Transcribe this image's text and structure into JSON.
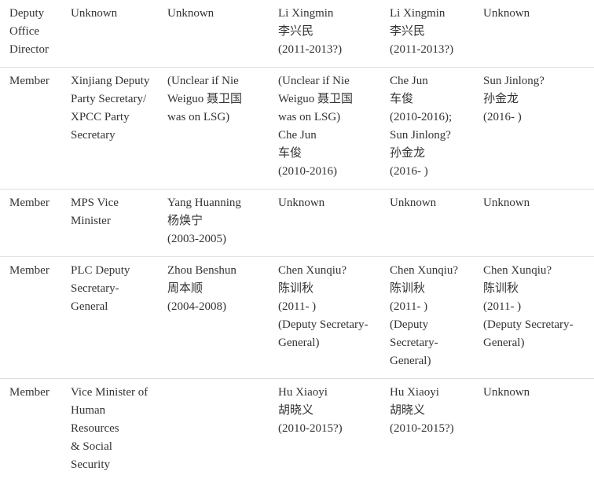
{
  "rows": [
    {
      "cells": [
        [
          "Deputy",
          "Office",
          "Director"
        ],
        [
          "Unknown"
        ],
        [
          "Unknown"
        ],
        [
          "Li Xingmin",
          "李兴民",
          "(2011-2013?)"
        ],
        [
          "Li Xingmin",
          "李兴民",
          "(2011-2013?)"
        ],
        [
          "Unknown"
        ]
      ]
    },
    {
      "cells": [
        [
          "Member"
        ],
        [
          "Xinjiang Deputy",
          "Party Secretary/",
          "XPCC Party",
          "Secretary"
        ],
        [
          "(Unclear if Nie",
          "Weiguo 聂卫国",
          "was on LSG)"
        ],
        [
          "(Unclear if Nie",
          "Weiguo 聂卫国",
          "was on LSG)",
          "Che Jun",
          "车俊",
          "(2010-2016)"
        ],
        [
          "Che Jun",
          "车俊",
          "(2010-2016);",
          "Sun Jinlong?",
          "孙金龙",
          "(2016- )"
        ],
        [
          "Sun Jinlong?",
          "孙金龙",
          "(2016- )"
        ]
      ]
    },
    {
      "cells": [
        [
          "Member"
        ],
        [
          "MPS Vice",
          "Minister"
        ],
        [
          "Yang Huanning",
          "杨焕宁",
          "(2003-2005)"
        ],
        [
          "Unknown"
        ],
        [
          "Unknown"
        ],
        [
          "Unknown"
        ]
      ]
    },
    {
      "cells": [
        [
          "Member"
        ],
        [
          "PLC Deputy",
          "Secretary-",
          "General"
        ],
        [
          "Zhou Benshun",
          "周本顺",
          "(2004-2008)"
        ],
        [
          "Chen Xunqiu?",
          "陈训秋",
          "(2011- )",
          "(Deputy Secretary-",
          "General)"
        ],
        [
          "Chen Xunqiu?",
          "陈训秋",
          "(2011- )",
          "(Deputy",
          "Secretary-",
          "General)"
        ],
        [
          "Chen Xunqiu?",
          "陈训秋",
          "(2011- )",
          "(Deputy Secretary-",
          "General)"
        ]
      ]
    },
    {
      "cells": [
        [
          "Member"
        ],
        [
          "Vice Minister of",
          "Human",
          "Resources",
          "& Social",
          "Security"
        ],
        [],
        [
          "Hu Xiaoyi",
          "胡晓义",
          "(2010-2015?)"
        ],
        [
          "Hu Xiaoyi",
          "胡晓义",
          "(2010-2015?)"
        ],
        [
          "Unknown"
        ]
      ]
    }
  ]
}
